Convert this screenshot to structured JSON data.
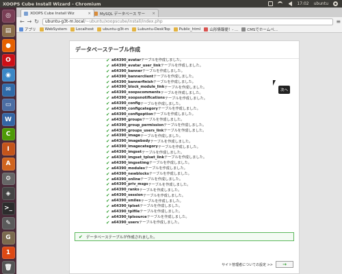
{
  "system": {
    "window_title": "XOOPS Cube Install Wizard - Chromium",
    "time": "17:02",
    "user": "ubuntu"
  },
  "launcher": {
    "apps": [
      {
        "icon": "ubuntu-logo-icon",
        "color": "#7a3e55",
        "glyph": "◎"
      },
      {
        "icon": "files-icon",
        "color": "#8a6e4b",
        "glyph": "▤"
      },
      {
        "icon": "firefox-icon",
        "color": "#e66000",
        "glyph": "●"
      },
      {
        "icon": "opera-icon",
        "color": "#cc0f16",
        "glyph": "O"
      },
      {
        "icon": "chromium-icon",
        "color": "#3b87c6",
        "glyph": "◉"
      },
      {
        "icon": "thunderbird-icon",
        "color": "#2f6aa8",
        "glyph": "✉"
      },
      {
        "icon": "document-icon",
        "color": "#4b6da3",
        "glyph": "▭"
      },
      {
        "icon": "writer-icon",
        "color": "#3465a4",
        "glyph": "W"
      },
      {
        "icon": "calc-icon",
        "color": "#4e9a06",
        "glyph": "C"
      },
      {
        "icon": "impress-icon",
        "color": "#c4541a",
        "glyph": "I"
      },
      {
        "icon": "software-center-icon",
        "color": "#d0641e",
        "glyph": "A"
      },
      {
        "icon": "settings-icon",
        "color": "#666666",
        "glyph": "⚙"
      },
      {
        "icon": "mysql-workbench-icon",
        "color": "#444444",
        "glyph": "◈"
      },
      {
        "icon": "terminal-icon",
        "color": "#2c2c2c",
        "glyph": ">_"
      },
      {
        "icon": "text-editor-icon",
        "color": "#5a5a5a",
        "glyph": "✎"
      },
      {
        "icon": "gimp-icon",
        "color": "#7b6a4e",
        "glyph": "G"
      },
      {
        "icon": "ubuntu-one-icon",
        "color": "#dd4814",
        "glyph": "1"
      },
      {
        "icon": "trash-icon",
        "color": "#555555",
        "glyph": "🗑"
      }
    ]
  },
  "browser": {
    "tabs": [
      {
        "label": "XOOPS Cube Install Wiz",
        "active": true
      },
      {
        "label": "MySQL データベース サー",
        "active": false
      }
    ],
    "url_host": "ubuntu-g3t-m.local",
    "url_path": "/~ubuntu/xoopscube/install/index.php",
    "bookmarks": [
      {
        "label": "アプリ",
        "icon_color": "#5b8dd9"
      },
      {
        "label": "WebSystem",
        "icon_color": "#e3b341"
      },
      {
        "label": "Localhost",
        "icon_color": "#e3b341"
      },
      {
        "label": "ubuntu-g3t-m",
        "icon_color": "#e3b341"
      },
      {
        "label": "Lubuntu-DeskTop",
        "icon_color": "#e3b341"
      },
      {
        "label": "Public_html",
        "icon_color": "#e3b341"
      },
      {
        "label": "山形情報便！- ...",
        "icon_color": "#d9534f"
      },
      {
        "label": "CMSでホームペ...",
        "icon_color": "#888888"
      }
    ]
  },
  "page": {
    "title": "データベーステーブル作成",
    "table_suffix": "テーブルを作成しました。",
    "tables": [
      "a64390_avatar",
      "a64390_avatar_user_link",
      "a64390_banner",
      "a64390_bannerclient",
      "a64390_bannerfinish",
      "a64390_block_module_link",
      "a64390_xoopscomments",
      "a64390_xoopsnotifications",
      "a64390_config",
      "a64390_configcategory",
      "a64390_configoption",
      "a64390_groups",
      "a64390_group_permission",
      "a64390_groups_users_link",
      "a64390_image",
      "a64390_imagebody",
      "a64390_imagecategory",
      "a64390_imgset",
      "a64390_imgset_tplset_link",
      "a64390_imgsetimg",
      "a64390_modules",
      "a64390_newblocks",
      "a64390_online",
      "a64390_priv_msgs",
      "a64390_ranks",
      "a64390_session",
      "a64390_smiles",
      "a64390_tplset",
      "a64390_tplfile",
      "a64390_tplsource",
      "a64390_users"
    ],
    "success_message": "データベーステーブルが作成されました。",
    "footer_label": "サイト管理者についての設定 >>",
    "next_symbol": "→",
    "tooltip": "次へ"
  }
}
